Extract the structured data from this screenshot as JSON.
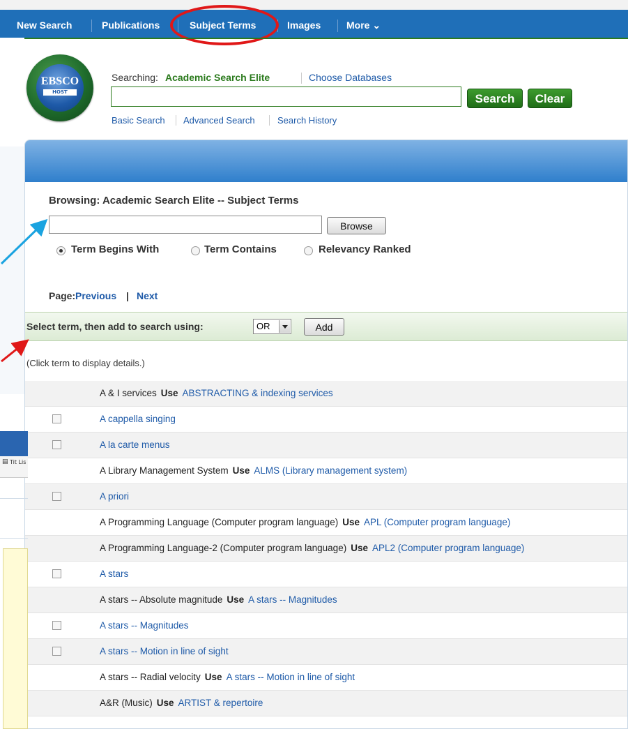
{
  "nav": {
    "items": [
      "New Search",
      "Publications",
      "Subject Terms",
      "Images",
      "More"
    ],
    "more_caret": "⌄"
  },
  "header": {
    "logo_top": "EBSCO",
    "logo_bottom": "HOST",
    "searching_label": "Searching:",
    "database": "Academic Search Elite",
    "choose_databases": "Choose Databases",
    "search_button": "Search",
    "clear_button": "Clear",
    "search_value": "",
    "links": [
      "Basic Search",
      "Advanced Search",
      "Search History"
    ]
  },
  "browse": {
    "title": "Browsing: Academic Search Elite -- Subject Terms",
    "input_value": "",
    "browse_button": "Browse",
    "options": [
      "Term Begins With",
      "Term Contains",
      "Relevancy Ranked"
    ],
    "selected_option": "Term Begins With"
  },
  "paging": {
    "label": "Page:",
    "previous": "Previous",
    "separator": "|",
    "next": "Next"
  },
  "addbar": {
    "label": "Select term, then add to search using:",
    "operator": "OR",
    "add_button": "Add"
  },
  "hint": "(Click term to display details.)",
  "use_label": "Use",
  "terms": [
    {
      "text": "A & I services",
      "checkbox": false,
      "use": "ABSTRACTING & indexing services"
    },
    {
      "text": "A cappella singing",
      "checkbox": true
    },
    {
      "text": "A la carte menus",
      "checkbox": true
    },
    {
      "text": "A Library Management System",
      "checkbox": false,
      "use": "ALMS (Library management system)"
    },
    {
      "text": "A priori",
      "checkbox": true
    },
    {
      "text": "A Programming Language (Computer program language)",
      "checkbox": false,
      "use": "APL (Computer program language)"
    },
    {
      "text": "A Programming Language-2 (Computer program language)",
      "checkbox": false,
      "use": "APL2 (Computer program language)"
    },
    {
      "text": "A stars",
      "checkbox": true
    },
    {
      "text": "A stars -- Absolute magnitude",
      "checkbox": false,
      "use": "A stars -- Magnitudes"
    },
    {
      "text": "A stars -- Magnitudes",
      "checkbox": true
    },
    {
      "text": "A stars -- Motion in line of sight",
      "checkbox": true
    },
    {
      "text": "A stars -- Radial velocity",
      "checkbox": false,
      "use": "A stars -- Motion in line of sight"
    },
    {
      "text": "A&R (Music)",
      "checkbox": false,
      "use": "ARTIST & repertoire"
    }
  ],
  "left_window": {
    "toolbar_text": "Tit Lis"
  },
  "colors": {
    "nav": "#1f6fb8",
    "accent_green": "#2b7a1d",
    "link": "#1e5aa8",
    "annotation_red": "#e01818",
    "annotation_blue": "#1aa3e0"
  }
}
